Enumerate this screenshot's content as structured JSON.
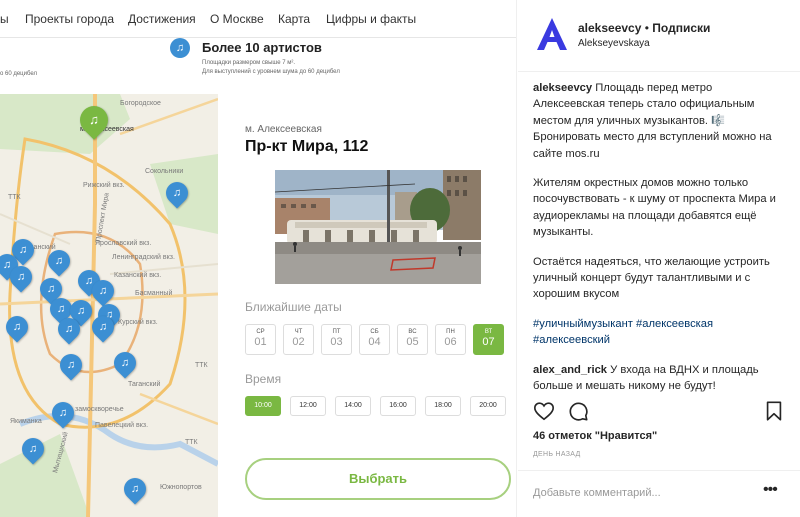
{
  "site": {
    "nav": [
      "ы",
      "Проекты города",
      "Достижения",
      "О Москве",
      "Карта",
      "Цифры и факты"
    ],
    "promo": {
      "note_left": "о 60 децибел",
      "badge_icon": "music-note-icon",
      "title": "Более 10 артистов",
      "line1": "Площадки размером свыше 7 м².",
      "line2": "Для выступлений с уровнем шума до 60 децибел"
    },
    "map_labels": [
      "Богородское",
      "м. Алексеевская",
      "Сокольники",
      "Рижский вкз.",
      "Мещанский",
      "ТТК",
      "Ярославский вкз.",
      "Ленинградский вкз.",
      "Казанский вкз.",
      "Басманный",
      "Курский вкз.",
      "Таганский",
      "Якиманка",
      "Павелецкий вкз.",
      "Южнопортов",
      "Проспект Мира",
      "замоскворечье",
      "ТТК",
      "ТТК",
      "Мытищиский"
    ],
    "card": {
      "metro": "м. Алексеевская",
      "address": "Пр-кт Мира, 112",
      "dates_label": "Ближайшие даты",
      "days": [
        {
          "name": "СР",
          "num": "01"
        },
        {
          "name": "ЧТ",
          "num": "02"
        },
        {
          "name": "ПТ",
          "num": "03"
        },
        {
          "name": "СБ",
          "num": "04"
        },
        {
          "name": "ВС",
          "num": "05"
        },
        {
          "name": "ПН",
          "num": "06"
        },
        {
          "name": "ВТ",
          "num": "07"
        }
      ],
      "active_day": 6,
      "time_label": "Время",
      "times": [
        "10:00",
        "12:00",
        "14:00",
        "16:00",
        "18:00",
        "20:00"
      ],
      "active_time": 0,
      "choose_label": "Выбрать"
    }
  },
  "instagram": {
    "username": "alekseevcy",
    "dot": " • ",
    "follow": "Подписки",
    "location": "Alekseyevskaya",
    "caption_user": "alekseevcy",
    "caption_p1": "Площадь перед метро Алексеевская теперь стало официальным местом для уличных музыкантов. 🎼 Бронировать место для вступлений можно на сайте mos.ru",
    "caption_p2": "Жителям окрестных домов можно только посочувствовать - к шуму от проспекта Мира и аудиорекламы на площади добавятся ещё музыканты.",
    "caption_p3": "Остаётся надеяться, что желающие устроить уличный концерт будут талантливыми и с хорошим вкусом",
    "hashtags": "#уличныймузыкант #алексеевская #алексеевский",
    "comment_user": "alex_and_rick",
    "comment_text": "У входа на ВДНХ и площадь больше и мешать никому не будут!",
    "likes": "46 отметок \"Нравится\"",
    "time_ago": "ДЕНЬ НАЗАД",
    "comment_placeholder": "Добавьте комментарий...",
    "more": "•••",
    "accent": "#3a3ae0",
    "green": "#7ab842",
    "pin_blue": "#3c8fd3"
  }
}
